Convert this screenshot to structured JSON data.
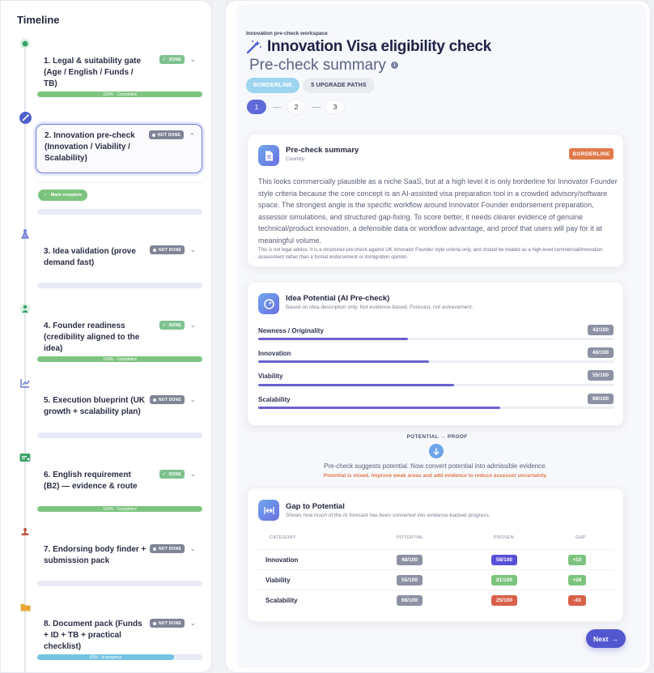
{
  "sidebar": {
    "title": "Timeline",
    "items": [
      {
        "label": "1. Legal & suitability gate (Age / English / Funds / TB)",
        "status": "DONE",
        "progress_label": "100% · Completed",
        "progress": 1.0
      },
      {
        "label": "2. Innovation pre-check (Innovation / Viability / Scalability)",
        "status": "NOT DONE",
        "mark_complete": "Mark complete",
        "progress": 0.0
      },
      {
        "label": "3. Idea validation (prove demand fast)",
        "status": "NOT DONE",
        "progress": 0.0
      },
      {
        "label": "4. Founder readiness (credibility aligned to the idea)",
        "status": "DONE",
        "progress_label": "100% · Completed",
        "progress": 1.0
      },
      {
        "label": "5. Execution blueprint (UK growth + scalability plan)",
        "status": "NOT DONE",
        "progress": 0.0
      },
      {
        "label": "6. English requirement (B2) — evidence & route",
        "status": "DONE",
        "progress_label": "100% · Completed",
        "progress": 1.0
      },
      {
        "label": "7. Endorsing body finder + submission pack",
        "status": "NOT DONE",
        "progress": 0.0
      },
      {
        "label": "8. Document pack (Funds + ID + TB + practical checklist)",
        "status": "NOT DONE",
        "progress_label": "83% · In progress",
        "progress": 0.83
      }
    ]
  },
  "header": {
    "breadcrumb": "Innovation pre-check workspace",
    "title": "Innovation Visa eligibility check",
    "subtitle": "Pre-check summary",
    "pill_status": "BORDERLINE",
    "pill_paths": "5 UPGRADE PATHS",
    "steps": [
      "1",
      "2",
      "3"
    ]
  },
  "summary": {
    "title": "Pre-check summary",
    "subtitle": "Country:",
    "tag": "BORDERLINE",
    "text": "This looks commercially plausible as a niche SaaS, but at a high level it is only borderline for Innovator Founder style criteria because the core concept is an AI-assisted visa preparation tool in a crowded advisory/software space. The strongest angle is the specific workflow around Innovator Founder endorsement preparation, assessor simulations, and structured gap-fixing. To score better, it needs clearer evidence of genuine technical/product innovation, a defensible data or workflow advantage, and proof that users will pay for it at meaningful volume.",
    "note": "This is not legal advice. It is a structured pre-check against UK Innovator Founder style criteria only, and should be treated as a high-level commercial/innovation assessment rather than a formal endorsement or immigration opinion."
  },
  "potential": {
    "title": "Idea Potential (AI Pre-check)",
    "subtitle": "Based on idea description only. Not evidence-based. Forecast, not achievement.",
    "metrics": [
      {
        "label": "Newness / Originality",
        "value": 42,
        "display": "42/100"
      },
      {
        "label": "Innovation",
        "value": 48,
        "display": "48/100"
      },
      {
        "label": "Viability",
        "value": 55,
        "display": "55/100"
      },
      {
        "label": "Scalability",
        "value": 68,
        "display": "68/100"
      }
    ]
  },
  "conversion": {
    "label": "POTENTIAL → PROOF",
    "text": "Pre-check suggests potential. Now convert potential into admissible evidence.",
    "warning": "Potential is mixed. Improve weak areas and add evidence to reduce assessor uncertainty."
  },
  "gap": {
    "title": "Gap to Potential",
    "subtitle": "Shows how much of the AI forecast has been converted into evidence-backed progress.",
    "headers": [
      "CATEGORY",
      "POTENTIAL",
      "PROVEN",
      "GAP"
    ],
    "rows": [
      {
        "category": "Innovation",
        "potential": "48/100",
        "proven": "58/100",
        "gap": "+10",
        "proven_color": "#5a4fd8",
        "gap_color": "#7cc47e"
      },
      {
        "category": "Viability",
        "potential": "55/100",
        "proven": "81/100",
        "gap": "+26",
        "proven_color": "#7cc47e",
        "gap_color": "#7cc47e"
      },
      {
        "category": "Scalability",
        "potential": "68/100",
        "proven": "25/100",
        "gap": "-43",
        "proven_color": "#d8604a",
        "gap_color": "#d8604a"
      }
    ]
  },
  "footer": {
    "next_label": "Next"
  },
  "colors": {
    "accent": "#5f6ad8",
    "done": "#7ec28f",
    "warn": "#e07a4a"
  }
}
